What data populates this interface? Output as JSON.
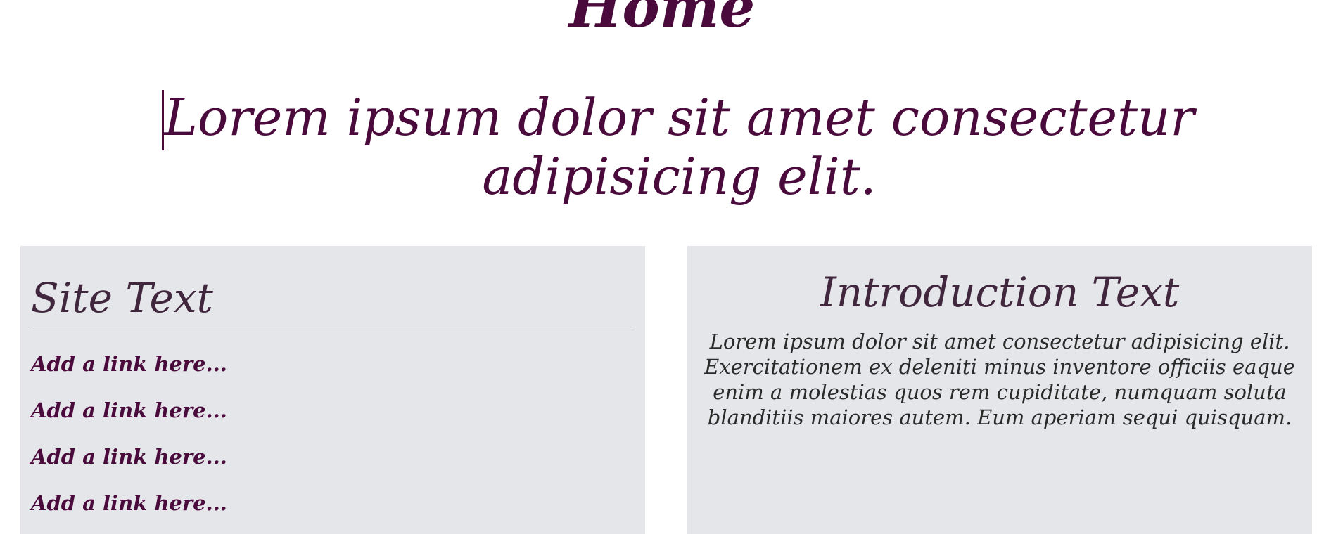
{
  "page": {
    "title": "Home",
    "quote": "Lorem ipsum dolor sit amet consectetur adipisicing elit."
  },
  "site_panel": {
    "heading": "Site Text",
    "links": [
      {
        "label": "Add a link here..."
      },
      {
        "label": "Add a link here..."
      },
      {
        "label": "Add a link here..."
      },
      {
        "label": "Add a link here..."
      }
    ]
  },
  "intro_panel": {
    "heading": "Introduction Text",
    "body": "Lorem ipsum dolor sit amet consectetur adipisicing elit. Exercitationem ex deleniti minus inventore officiis eaque enim a molestias quos rem cupiditate, numquam soluta blanditiis maiores autem. Eum aperiam sequi quisquam."
  },
  "colors": {
    "accent": "#4a0a3c",
    "panel_background": "#e5e6ea",
    "heading_text": "#41273d",
    "body_text": "#2a2a2a"
  }
}
